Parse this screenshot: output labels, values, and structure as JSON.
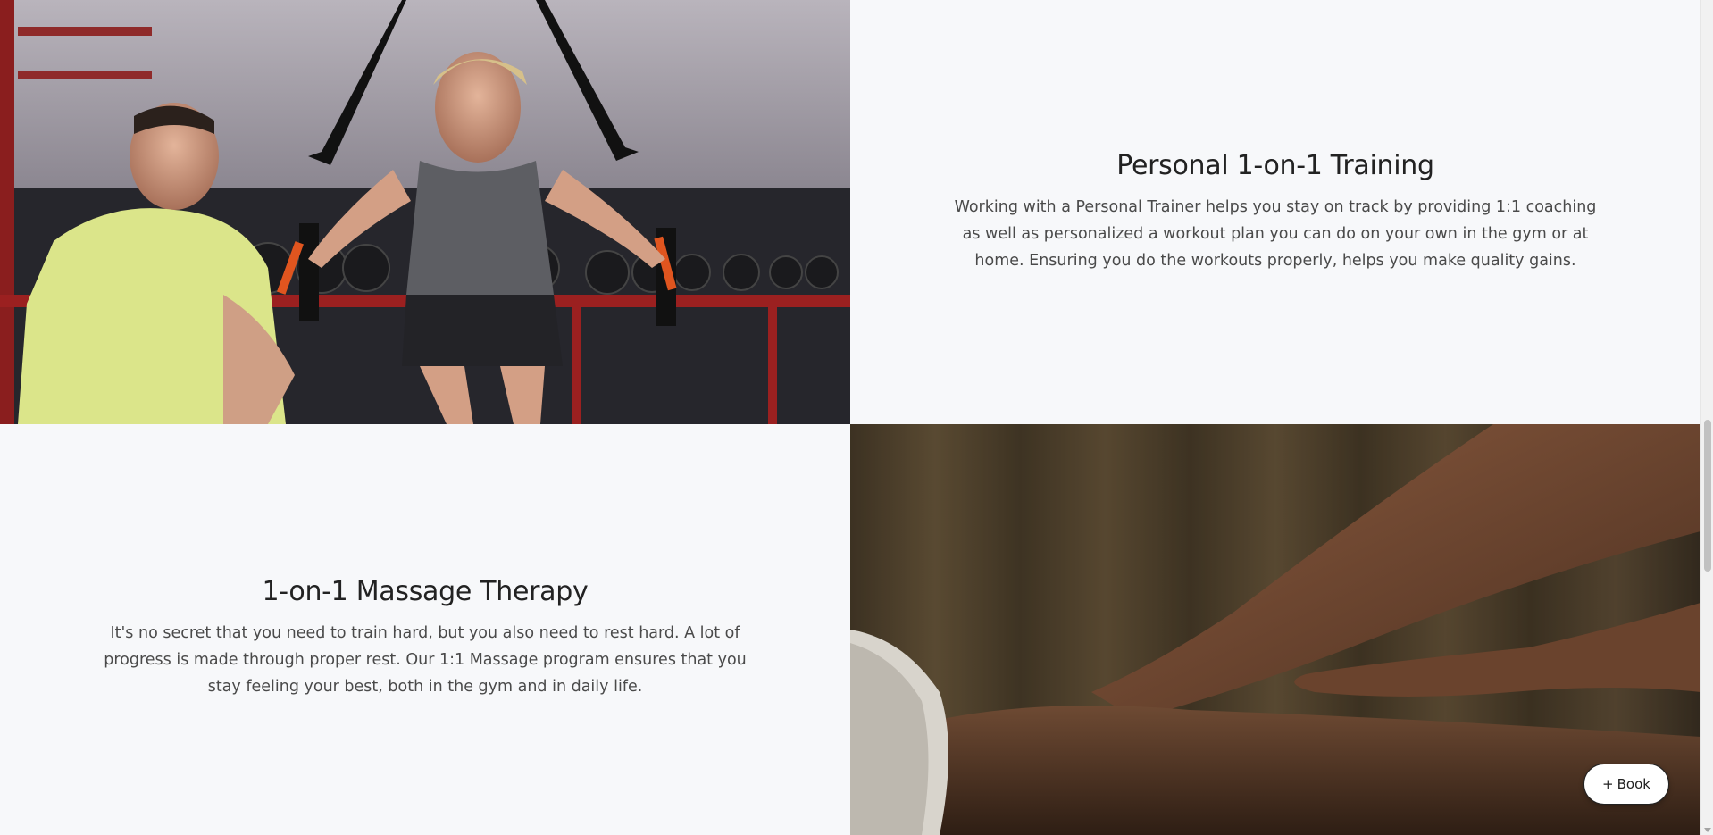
{
  "sections": [
    {
      "title": "Personal 1-on-1 Training",
      "description": "Working with a Personal Trainer helps you stay on track by providing 1:1 coaching as well as personalized a workout plan you can do on your own in the gym or at home. Ensuring you do the workouts properly, helps you make quality gains."
    },
    {
      "title": "1-on-1 Massage Therapy",
      "description": "It's no secret that you need to train hard, but you also need to rest hard. A lot of progress is made through proper rest. Our 1:1 Massage program ensures that you stay feeling your best, both in the gym and in daily life."
    }
  ],
  "book_button": {
    "icon": "+",
    "label": "Book"
  },
  "colors": {
    "page_background": "#f7f8fa",
    "heading": "#222222",
    "body_text": "#4a4a4a"
  }
}
